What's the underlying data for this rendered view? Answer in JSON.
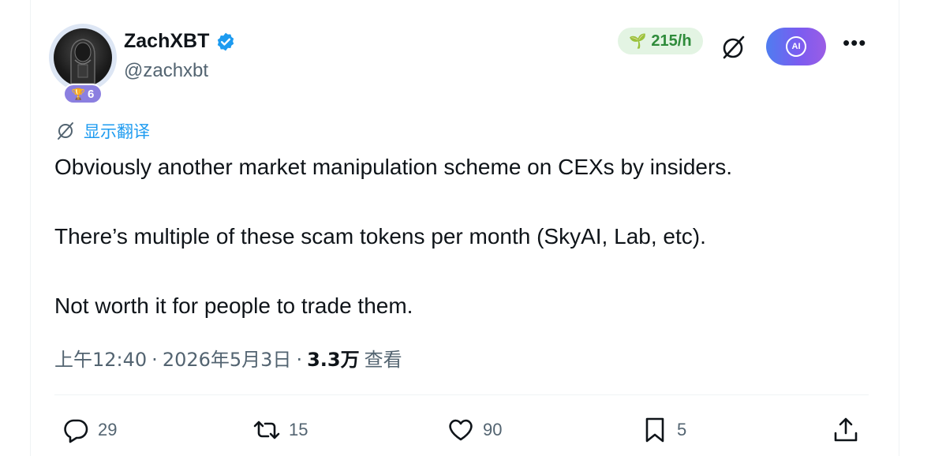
{
  "author": {
    "name": "ZachXBT",
    "handle": "@zachxbt",
    "badge_count": "6"
  },
  "toolbar": {
    "rate": "215/h"
  },
  "translate": {
    "label": "显示翻译"
  },
  "tweet": {
    "lines": [
      "Obviously another market manipulation scheme on CEXs by insiders.",
      "There’s multiple of these scam tokens per month (SkyAI, Lab, etc).",
      "Not worth it for people to trade them."
    ]
  },
  "meta": {
    "time": "上午12:40",
    "sep1": "·",
    "date": "2026年5月3日",
    "sep2": "·",
    "views": "3.3万",
    "views_label": "查看"
  },
  "actions": {
    "replies": "29",
    "reposts": "15",
    "likes": "90",
    "bookmarks": "5"
  },
  "colors": {
    "accent": "#1d9bf0",
    "muted": "#536471",
    "rate_green": "#2e8b3a",
    "badge_purple": "#8b7fe0"
  },
  "icons": [
    "verified-icon",
    "sprout-icon",
    "translate-icon",
    "ai-icon",
    "more-icon",
    "reply-icon",
    "repost-icon",
    "like-icon",
    "bookmark-icon",
    "share-icon",
    "trophy-icon"
  ]
}
